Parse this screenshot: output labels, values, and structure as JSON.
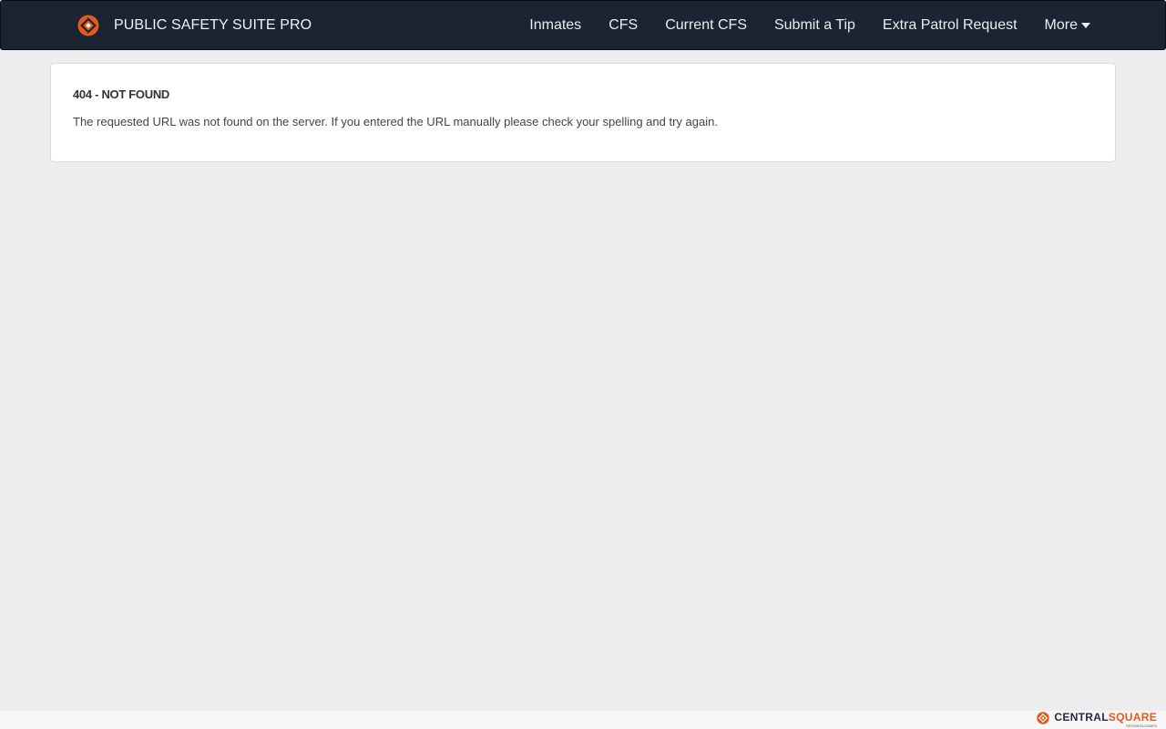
{
  "app": {
    "brand_name": "PUBLIC SAFETY SUITE PRO"
  },
  "nav": {
    "items": [
      "Inmates",
      "CFS",
      "Current CFS",
      "Submit a Tip",
      "Extra Patrol Request"
    ],
    "more_label": "More"
  },
  "error": {
    "title": "404 - NOT FOUND",
    "message": "The requested URL was not found on the server. If you entered the URL manually please check your spelling and try again."
  },
  "footer": {
    "brand_part1": "CENTRAL",
    "brand_part2": "SQUARE",
    "brand_sub": "TECHNOLOGIES"
  },
  "colors": {
    "navbar_bg": "#1b2433",
    "accent": "#e25a1c",
    "page_bg": "#ededed"
  },
  "icons": {
    "brand_logo": "centralsquare-logo-icon",
    "more_caret": "caret-down-icon"
  }
}
